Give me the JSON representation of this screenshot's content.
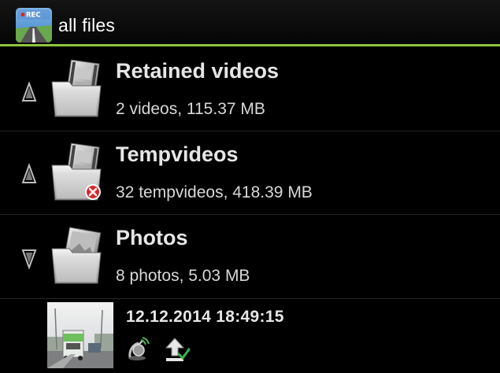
{
  "actionbar": {
    "app_icon": "rec-camera-road-icon",
    "app_icon_text": "REC",
    "title": "all files",
    "accent_color": "#8dc63f"
  },
  "groups": [
    {
      "title": "Retained videos",
      "subtitle": "2 videos, 115.37 MB",
      "expanded": false,
      "icon": "video-folder-icon"
    },
    {
      "title": "Tempvideos",
      "subtitle": "32 tempvideos, 418.39 MB",
      "expanded": false,
      "icon": "video-folder-delete-icon"
    },
    {
      "title": "Photos",
      "subtitle": "8 photos, 5.03 MB",
      "expanded": true,
      "icon": "photo-folder-icon"
    }
  ],
  "photos": [
    {
      "timestamp": "12.12.2014 18:49:15",
      "icons": [
        "gps-location-icon",
        "uploaded-check-icon"
      ]
    }
  ]
}
